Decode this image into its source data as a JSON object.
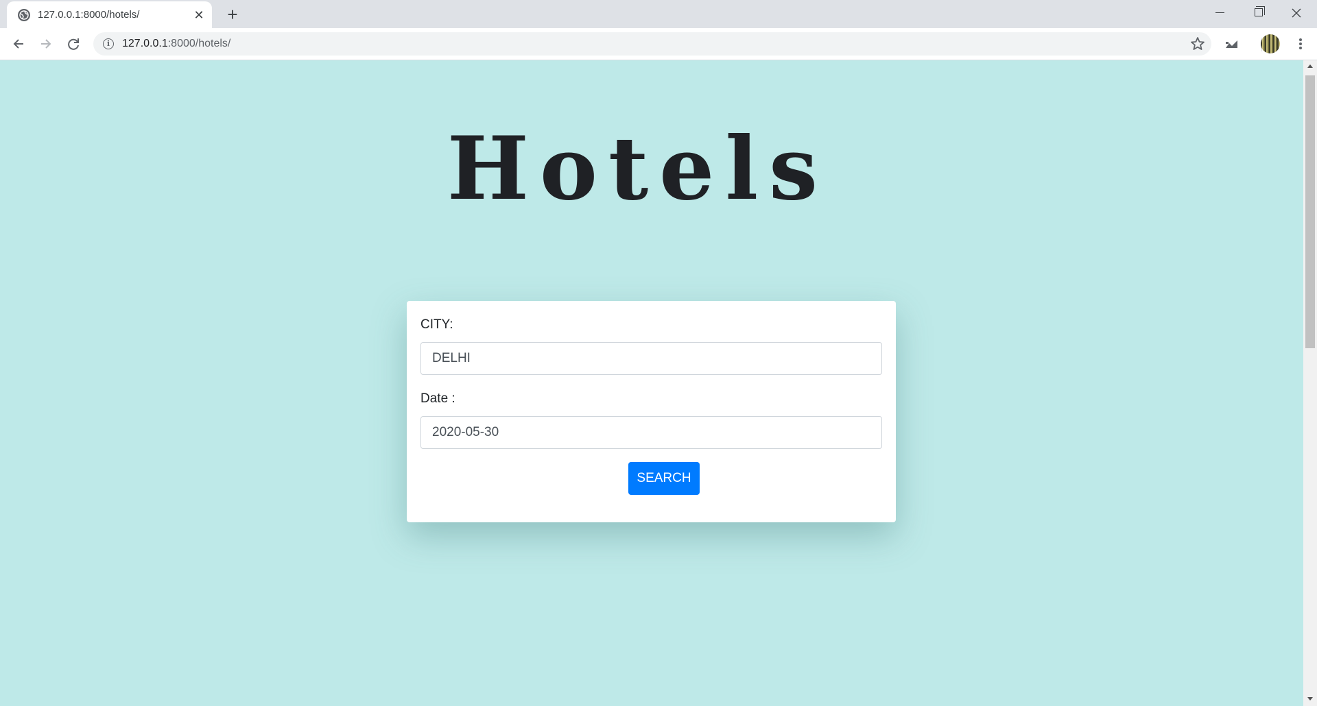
{
  "browser": {
    "tab_title": "127.0.0.1:8000/hotels/",
    "tab_close": "✕",
    "new_tab": "+",
    "url_host": "127.0.0.1",
    "url_path": ":8000/hotels/",
    "info_glyph": "i"
  },
  "page": {
    "title": "Hotels"
  },
  "form": {
    "city_label": "CITY:",
    "city_value": "DELHI",
    "date_label": "Date :",
    "date_value": "2020-05-30",
    "search_label": "SEARCH"
  },
  "colors": {
    "page_background": "#bee9e8",
    "button": "#007bff"
  },
  "icons": [
    "globe-icon",
    "close-icon",
    "plus-icon",
    "back-icon",
    "forward-icon",
    "reload-icon",
    "info-icon",
    "star-icon",
    "extension-icon",
    "avatar",
    "menu-icon"
  ]
}
